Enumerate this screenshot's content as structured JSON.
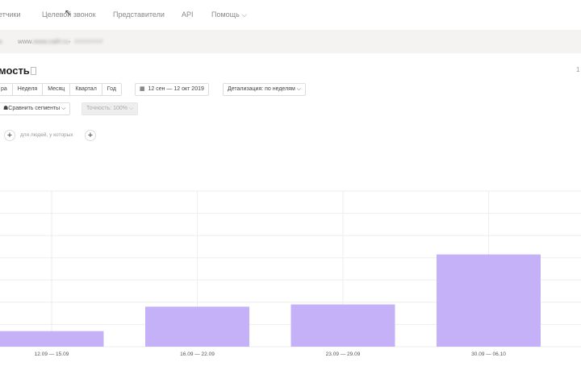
{
  "nav": {
    "items": [
      "етчики",
      "Целевой звонок",
      "Представители",
      "API",
      "Помощь"
    ]
  },
  "breadcrumb": {
    "prefix": "а",
    "site": "www.сайт.ru",
    "sep": "-",
    "counter": "########"
  },
  "page": {
    "title": "мость",
    "right_text": "1"
  },
  "period": {
    "options": [
      "ра",
      "Неделя",
      "Месяц",
      "Квартал",
      "Год"
    ],
    "date_range": "12 сен — 12 окт 2019",
    "detail": "Детализация: по неделям"
  },
  "controls": {
    "compare": "Сравнить сегменты",
    "accuracy": "Точность: 100%"
  },
  "segment": {
    "hint": "для людей, у которых"
  },
  "colors": {
    "bar": "#c4b1f8",
    "grid": "#eeeeee"
  },
  "chart_data": {
    "type": "bar",
    "categories": [
      "12.09 — 15.09",
      "16.09 — 22.09",
      "23.09 — 29.09",
      "30.09 — 06.10"
    ],
    "values": [
      0.7,
      1.8,
      1.9,
      4.15
    ],
    "ylim": [
      0,
      7
    ],
    "grid": true,
    "title": "",
    "xlabel": "",
    "ylabel": ""
  }
}
